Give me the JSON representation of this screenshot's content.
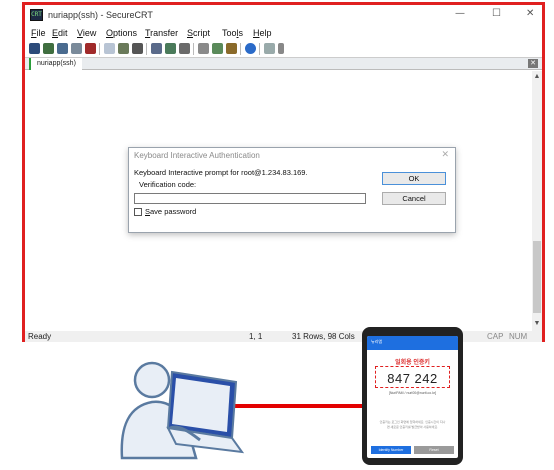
{
  "window": {
    "title": "nuriapp(ssh) - SecureCRT",
    "app_icon_text": "CRT",
    "controls": {
      "minimize": "—",
      "maximize": "☐",
      "close": "✕"
    },
    "border_color": "#e02020"
  },
  "menu": {
    "items": [
      {
        "u": "F",
        "rest": "ile"
      },
      {
        "u": "E",
        "rest": "dit"
      },
      {
        "u": "V",
        "rest": "iew"
      },
      {
        "u": "O",
        "rest": "ptions"
      },
      {
        "u": "T",
        "rest": "ransfer"
      },
      {
        "u": "S",
        "rest": "cript"
      },
      {
        "pre": "Too",
        "u": "l",
        "rest": "s"
      },
      {
        "u": "H",
        "rest": "elp"
      }
    ]
  },
  "toolbar": {
    "icons": [
      "connect-icon",
      "quick-connect-icon",
      "connect-tab-icon",
      "reconnect-icon",
      "disconnect-icon",
      "copy-icon",
      "paste-icon",
      "find-icon",
      "print-icon",
      "print-screen-icon",
      "log-icon",
      "session-options-icon",
      "global-options-icon",
      "keymap-icon",
      "help-icon",
      "sftp-icon",
      "more-icon"
    ]
  },
  "tabs": [
    {
      "label": "nuriapp(ssh)",
      "active": true
    }
  ],
  "tab_close": "✕",
  "scroll": {
    "up": "▲",
    "down": "▼"
  },
  "status": {
    "ready": "Ready",
    "cursor": "1,  1",
    "size": "31 Rows,  98 Cols",
    "caps": "CAP",
    "num": "NUM"
  },
  "dialog": {
    "title": "Keyboard Interactive Authentication",
    "close": "✕",
    "prompt": "Keyboard Interactive prompt for root@1.234.83.169.",
    "field_label": "Verification code:",
    "field_value": "",
    "save_password_u": "S",
    "save_password_rest": "ave password",
    "save_password_checked": false,
    "ok_label": "OK",
    "cancel_label": "Cancel"
  },
  "phone": {
    "header": "뉴리앱",
    "title": "일회용 인증키",
    "otp": "847 242",
    "account": "[NuriPAM / nuri00@nurit.co.kr]",
    "description": "인증키는 로그인 화면에 입력하세요. 인증시간이 지나면 새로운 인증키를 발급받아 사용하세요.",
    "button_primary": "Identify Number",
    "button_secondary": "Reset"
  },
  "illustration": {
    "cable_color": "#e30000",
    "person_color": "#5a7aa0",
    "laptop_color": "#2a4fa8"
  }
}
